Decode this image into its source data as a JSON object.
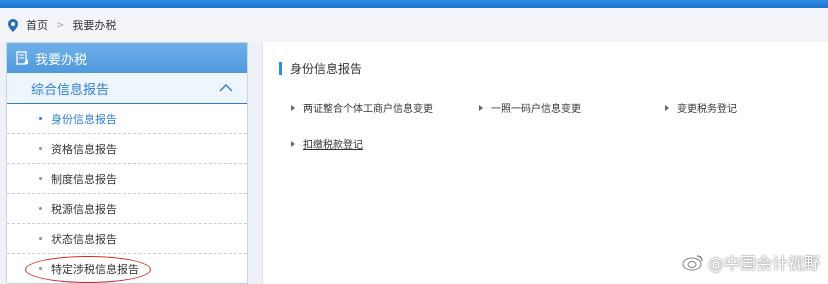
{
  "breadcrumb": {
    "home": "首页",
    "current": "我要办税"
  },
  "sidebar": {
    "header": "我要办税",
    "section": "综合信息报告",
    "items": [
      {
        "label": "身份信息报告"
      },
      {
        "label": "资格信息报告"
      },
      {
        "label": "制度信息报告"
      },
      {
        "label": "税源信息报告"
      },
      {
        "label": "状态信息报告"
      },
      {
        "label": "特定涉税信息报告"
      }
    ]
  },
  "content": {
    "title": "身份信息报告",
    "links": [
      {
        "label": "两证整合个体工商户信息变更"
      },
      {
        "label": "一照一码户信息变更"
      },
      {
        "label": "变更税务登记"
      },
      {
        "label": "扣缴税款登记"
      }
    ]
  },
  "watermark": "@中国会计视野",
  "colors": {
    "accent": "#2d7fd3",
    "highlight": "#d7251d"
  }
}
